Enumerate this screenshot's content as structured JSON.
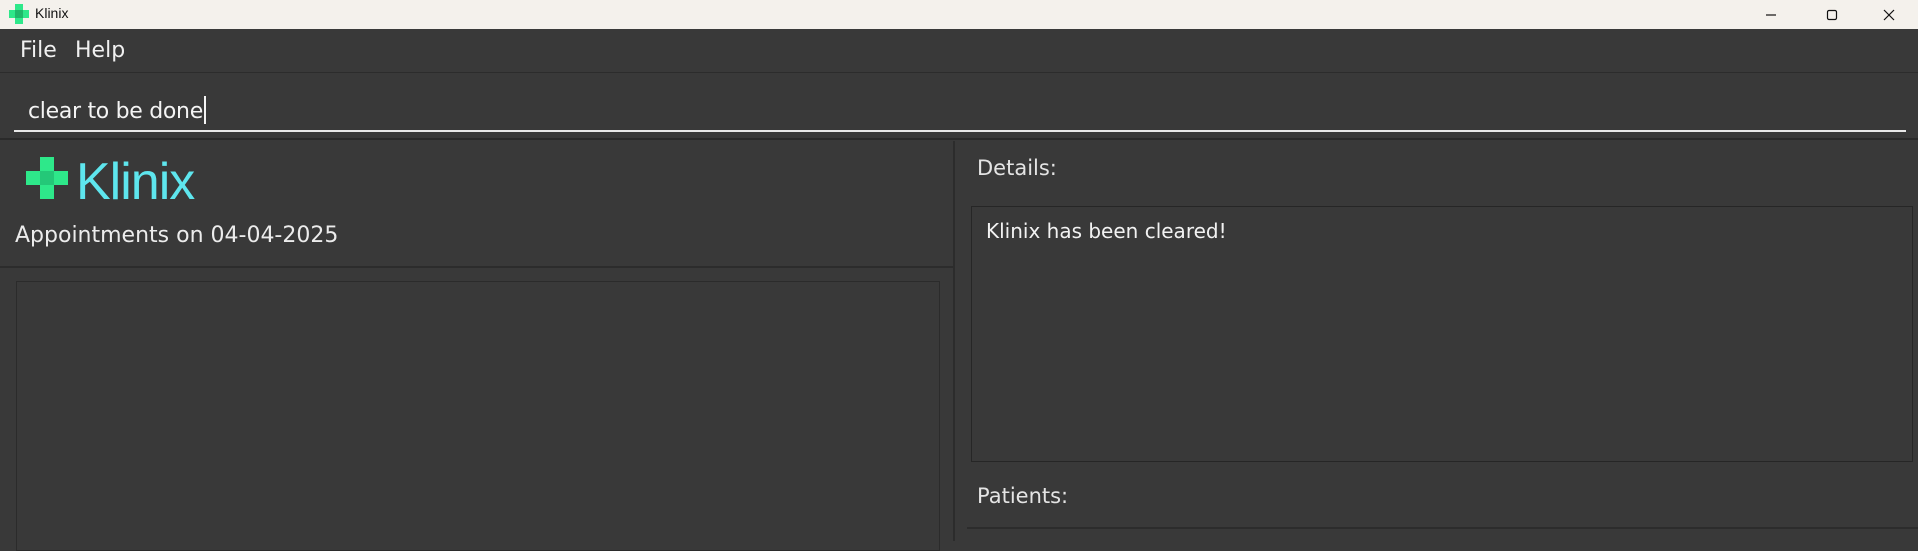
{
  "window": {
    "title": "Klinix",
    "controls": {
      "minimize_icon": "minimize-icon",
      "maximize_icon": "maximize-icon",
      "close_icon": "close-icon"
    }
  },
  "menu": {
    "items": [
      {
        "label": "File"
      },
      {
        "label": "Help"
      }
    ]
  },
  "command": {
    "value": "clear to be done"
  },
  "appointments": {
    "logo_text": "Klinix",
    "title": "Appointments on 04-04-2025",
    "items": []
  },
  "details": {
    "label": "Details:",
    "message": "Klinix has been cleared!"
  },
  "patients": {
    "label": "Patients:"
  },
  "colors": {
    "background": "#393939",
    "titlebar": "#f4f1ec",
    "logo_cross": "#2ee88a",
    "logo_text": "#5ee6ee",
    "text": "#f0f0f0"
  }
}
